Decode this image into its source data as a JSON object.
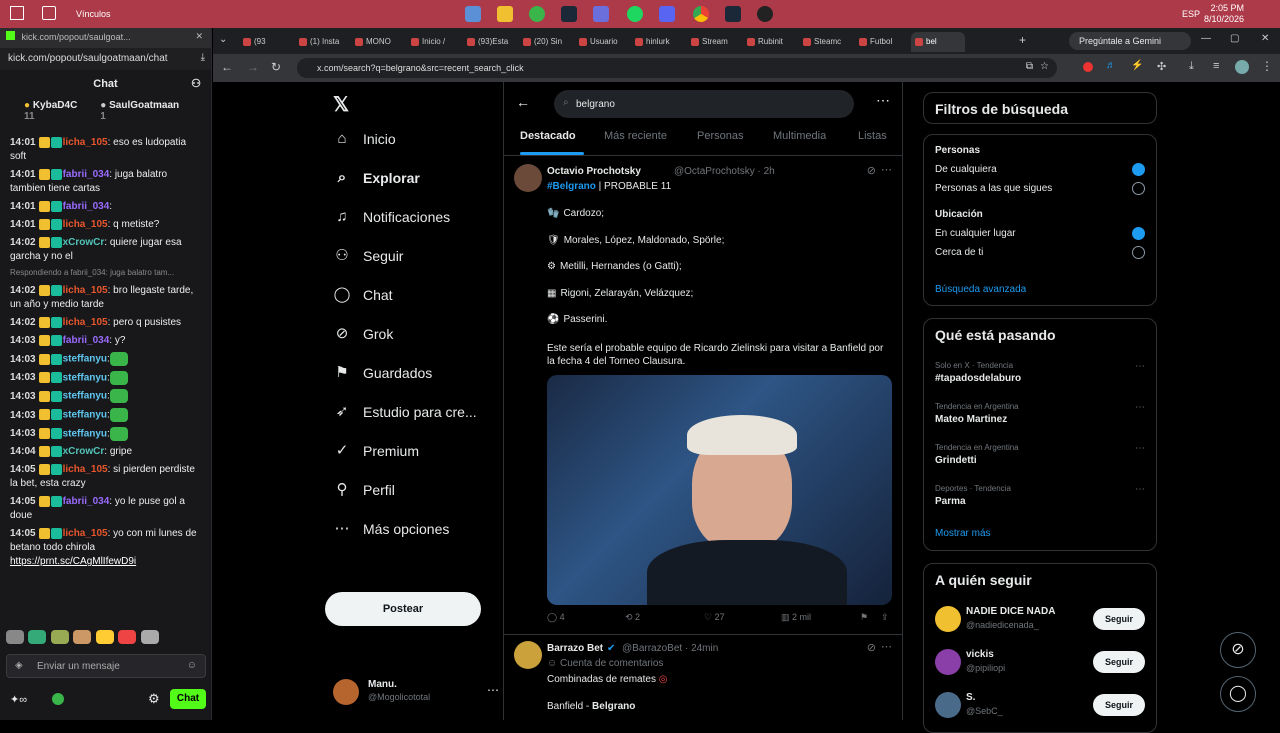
{
  "taskbar": {
    "vinculos": "Vínculos",
    "lang": "ESP",
    "time": "2:05 PM",
    "date": "8/10/2026"
  },
  "kick": {
    "title": "kick.com/popout/saulgoat...",
    "url": "kick.com/popout/saulgoatmaan/chat",
    "chat_header": "Chat",
    "pinned": [
      {
        "name": "KybaD4C",
        "count": "11"
      },
      {
        "name": "SaulGoatmaan",
        "count": "1"
      }
    ],
    "messages": [
      {
        "time": "14:01",
        "user": "licha_105",
        "cls": "u1",
        "text": ": eso es ludopatia soft"
      },
      {
        "time": "14:01",
        "user": "fabrii_034",
        "cls": "u2",
        "text": ": juga balatro tambien tiene cartas"
      },
      {
        "time": "14:01",
        "user": "fabrii_034",
        "cls": "u2",
        "text": ":"
      },
      {
        "time": "14:01",
        "user": "licha_105",
        "cls": "u1",
        "text": ": q metiste?"
      },
      {
        "time": "14:02",
        "user": "xCrowCr",
        "cls": "u3",
        "text": ": quiere jugar esa garcha y no el"
      },
      {
        "time": "14:02",
        "user": "licha_105",
        "cls": "u1",
        "text": ": bro llegaste tarde, un año y medio tarde"
      },
      {
        "time": "14:02",
        "user": "licha_105",
        "cls": "u1",
        "text": ": pero q pusistes"
      },
      {
        "time": "14:03",
        "user": "fabrii_034",
        "cls": "u2",
        "text": ": y?"
      },
      {
        "time": "14:03",
        "user": "steffanyu",
        "cls": "u4",
        "text": ":"
      },
      {
        "time": "14:03",
        "user": "steffanyu",
        "cls": "u4",
        "text": ":"
      },
      {
        "time": "14:03",
        "user": "steffanyu",
        "cls": "u4",
        "text": ":"
      },
      {
        "time": "14:03",
        "user": "steffanyu",
        "cls": "u4",
        "text": ":"
      },
      {
        "time": "14:03",
        "user": "steffanyu",
        "cls": "u4",
        "text": ":"
      },
      {
        "time": "14:04",
        "user": "xCrowCr",
        "cls": "u3",
        "text": ": gripe"
      },
      {
        "time": "14:05",
        "user": "licha_105",
        "cls": "u1",
        "text": ": si pierden perdiste la bet, esta crazy"
      },
      {
        "time": "14:05",
        "user": "fabrii_034",
        "cls": "u2",
        "text": ": yo le puse gol a doue"
      },
      {
        "time": "14:05",
        "user": "licha_105",
        "cls": "u1",
        "text": ": yo con mi lunes de betano todo chirola"
      }
    ],
    "reply_note": "Respondiendo a fabrii_034: juga balatro tam...",
    "link": "https://prnt.sc/CAgMlIfewD9i",
    "input_placeholder": "Enviar un mensaje",
    "chat_button": "Chat"
  },
  "tabs": [
    "(93",
    "(1) Insta",
    "MONO",
    "Inicio /",
    "(93)Esta",
    "(20) Sin",
    "Usuario",
    "hinlurk",
    "Stream",
    "Rubinit",
    "Steamc",
    "Futbol",
    "bel"
  ],
  "gemini": "Pregúntale a Gemini",
  "address": "x.com/search?q=belgrano&src=recent_search_click",
  "nav": [
    {
      "label": "Inicio",
      "icon": "⌂"
    },
    {
      "label": "Explorar",
      "icon": "⌕"
    },
    {
      "label": "Notificaciones",
      "icon": "♫"
    },
    {
      "label": "Seguir",
      "icon": "⚇"
    },
    {
      "label": "Chat",
      "icon": "◯"
    },
    {
      "label": "Grok",
      "icon": "⊘"
    },
    {
      "label": "Guardados",
      "icon": "⚑"
    },
    {
      "label": "Estudio para cre...",
      "icon": "➶"
    },
    {
      "label": "Premium",
      "icon": "✓"
    },
    {
      "label": "Perfil",
      "icon": "⚲"
    },
    {
      "label": "Más opciones",
      "icon": "⋯"
    }
  ],
  "post_button": "Postear",
  "account": {
    "name": "Manu.",
    "handle": "@Mogolicototal"
  },
  "search": {
    "query": "belgrano"
  },
  "center_tabs": [
    "Destacado",
    "Más reciente",
    "Personas",
    "Multimedia",
    "Listas"
  ],
  "tweet1": {
    "name": "Octavio Prochotsky",
    "handle": "@OctaProchotsky · 2h",
    "hashtag": "#Belgrano",
    "tag_rest": " | PROBABLE 11",
    "lines": [
      "Cardozo;",
      "Morales, López, Maldonado, Spörle;",
      "Metilli, Hernandes (o Gatti);",
      "Rigoni, Zelarayán, Velázquez;",
      "Passerini."
    ],
    "line_icons": [
      "🧤",
      "🛡",
      "⚙",
      "▦",
      "⚽"
    ],
    "body": "Este sería el probable equipo de Ricardo Zielinski para visitar a Banfield por la fecha 4 del Torneo Clausura.",
    "stats": {
      "replies": "4",
      "reposts": "2",
      "likes": "27",
      "views": "2 mil"
    }
  },
  "tweet2": {
    "name": "Barrazo Bet",
    "handle": "@BarrazoBet · 24min",
    "sub": "Cuenta de comentarios",
    "text": "Combinadas de remates",
    "line": "Banfield - ",
    "line_bold": "Belgrano"
  },
  "filters": {
    "title": "Filtros de búsqueda",
    "personas_h": "Personas",
    "p1": "De cualquiera",
    "p2": "Personas a las que sigues",
    "ubic_h": "Ubicación",
    "u1": "En cualquier lugar",
    "u2": "Cerca de ti",
    "advanced": "Búsqueda avanzada"
  },
  "trends": {
    "title": "Qué está pasando",
    "items": [
      {
        "ctx": "Solo en X · Tendencia",
        "name": "#tapadosdelaburo"
      },
      {
        "ctx": "Tendencia en Argentina",
        "name": "Mateo Martinez"
      },
      {
        "ctx": "Tendencia en Argentina",
        "name": "Grindetti"
      },
      {
        "ctx": "Deportes · Tendencia",
        "name": "Parma"
      }
    ],
    "more": "Mostrar más"
  },
  "follow": {
    "title": "A quién seguir",
    "items": [
      {
        "name": "NADIE DICE NADA",
        "handle": "@nadiedicenada_"
      },
      {
        "name": "vickis",
        "handle": "@pipiliopi"
      },
      {
        "name": "S.",
        "handle": "@SebC_"
      }
    ],
    "button": "Seguir"
  },
  "colors": {
    "accent": "#1d9bf0",
    "kick": "#53fc18",
    "taskbar": "#ad3a49"
  }
}
